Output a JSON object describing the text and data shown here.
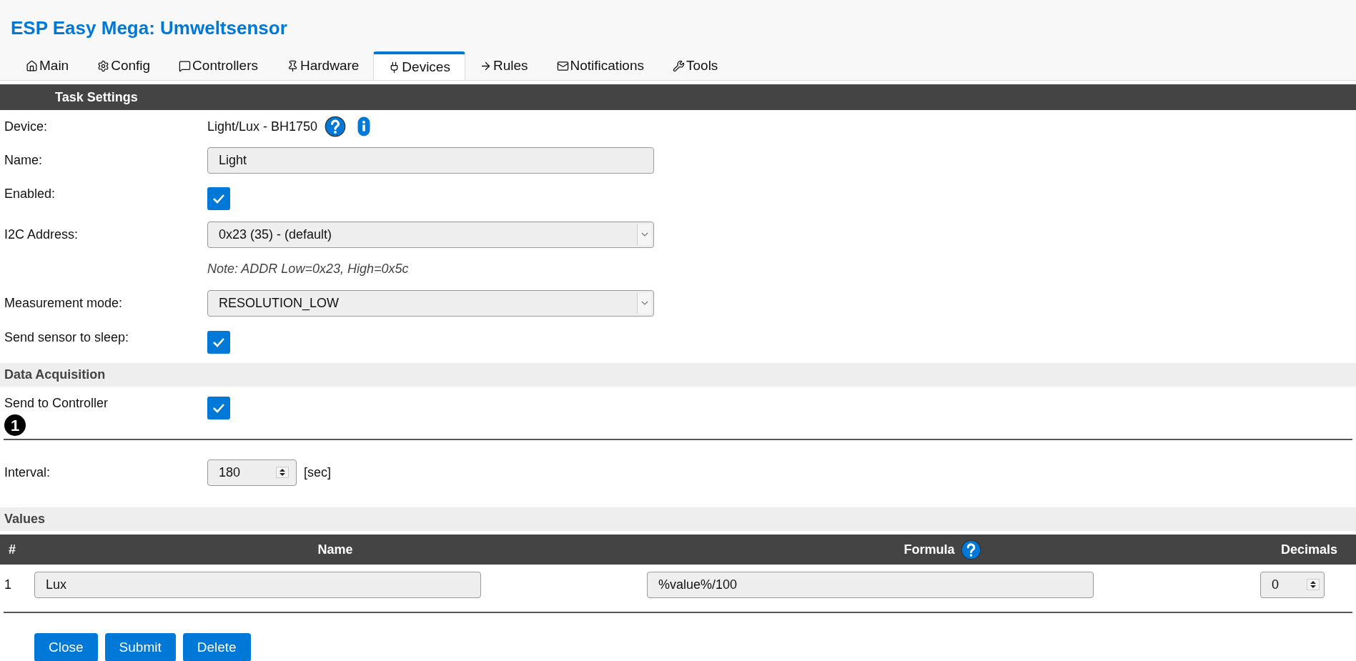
{
  "title": "ESP Easy Mega: Umweltsensor",
  "tabs": [
    {
      "label": "Main",
      "selected": false
    },
    {
      "label": "Config",
      "selected": false
    },
    {
      "label": "Controllers",
      "selected": false
    },
    {
      "label": "Hardware",
      "selected": false
    },
    {
      "label": "Devices",
      "selected": true
    },
    {
      "label": "Rules",
      "selected": false
    },
    {
      "label": "Notifications",
      "selected": false
    },
    {
      "label": "Tools",
      "selected": false
    }
  ],
  "task_settings": {
    "heading": "Task Settings",
    "rows": [
      {
        "kind": "device",
        "label": "Device:",
        "value": "Light/Lux - BH1750"
      },
      {
        "kind": "text",
        "label": "Name:",
        "value": "Light"
      },
      {
        "kind": "checkbox",
        "label": "Enabled:",
        "checked": true
      },
      {
        "kind": "select",
        "label": "I2C Address:",
        "value": "0x23 (35) - (default)"
      },
      {
        "kind": "note",
        "text": "Note: ADDR Low=0x23, High=0x5c"
      },
      {
        "kind": "select",
        "label": "Measurement mode:",
        "value": "RESOLUTION_LOW"
      },
      {
        "kind": "checkbox",
        "label": "Send sensor to sleep:",
        "checked": true
      }
    ]
  },
  "data_acquisition": {
    "heading": "Data Acquisition",
    "rows": [
      {
        "kind": "checkbox",
        "label": "Send to Controller",
        "marker": "1",
        "checked": true
      },
      {
        "kind": "number",
        "label": "Interval:",
        "value": "180",
        "unit": "[sec]"
      }
    ]
  },
  "values": {
    "heading": "Values",
    "columns": [
      "#",
      "Name",
      "Formula",
      "Decimals"
    ],
    "rows": [
      {
        "index": "1",
        "name": "Lux",
        "formula": "%value%/100",
        "decimals": "0"
      }
    ]
  },
  "buttons": [
    "Close",
    "Submit",
    "Delete"
  ]
}
